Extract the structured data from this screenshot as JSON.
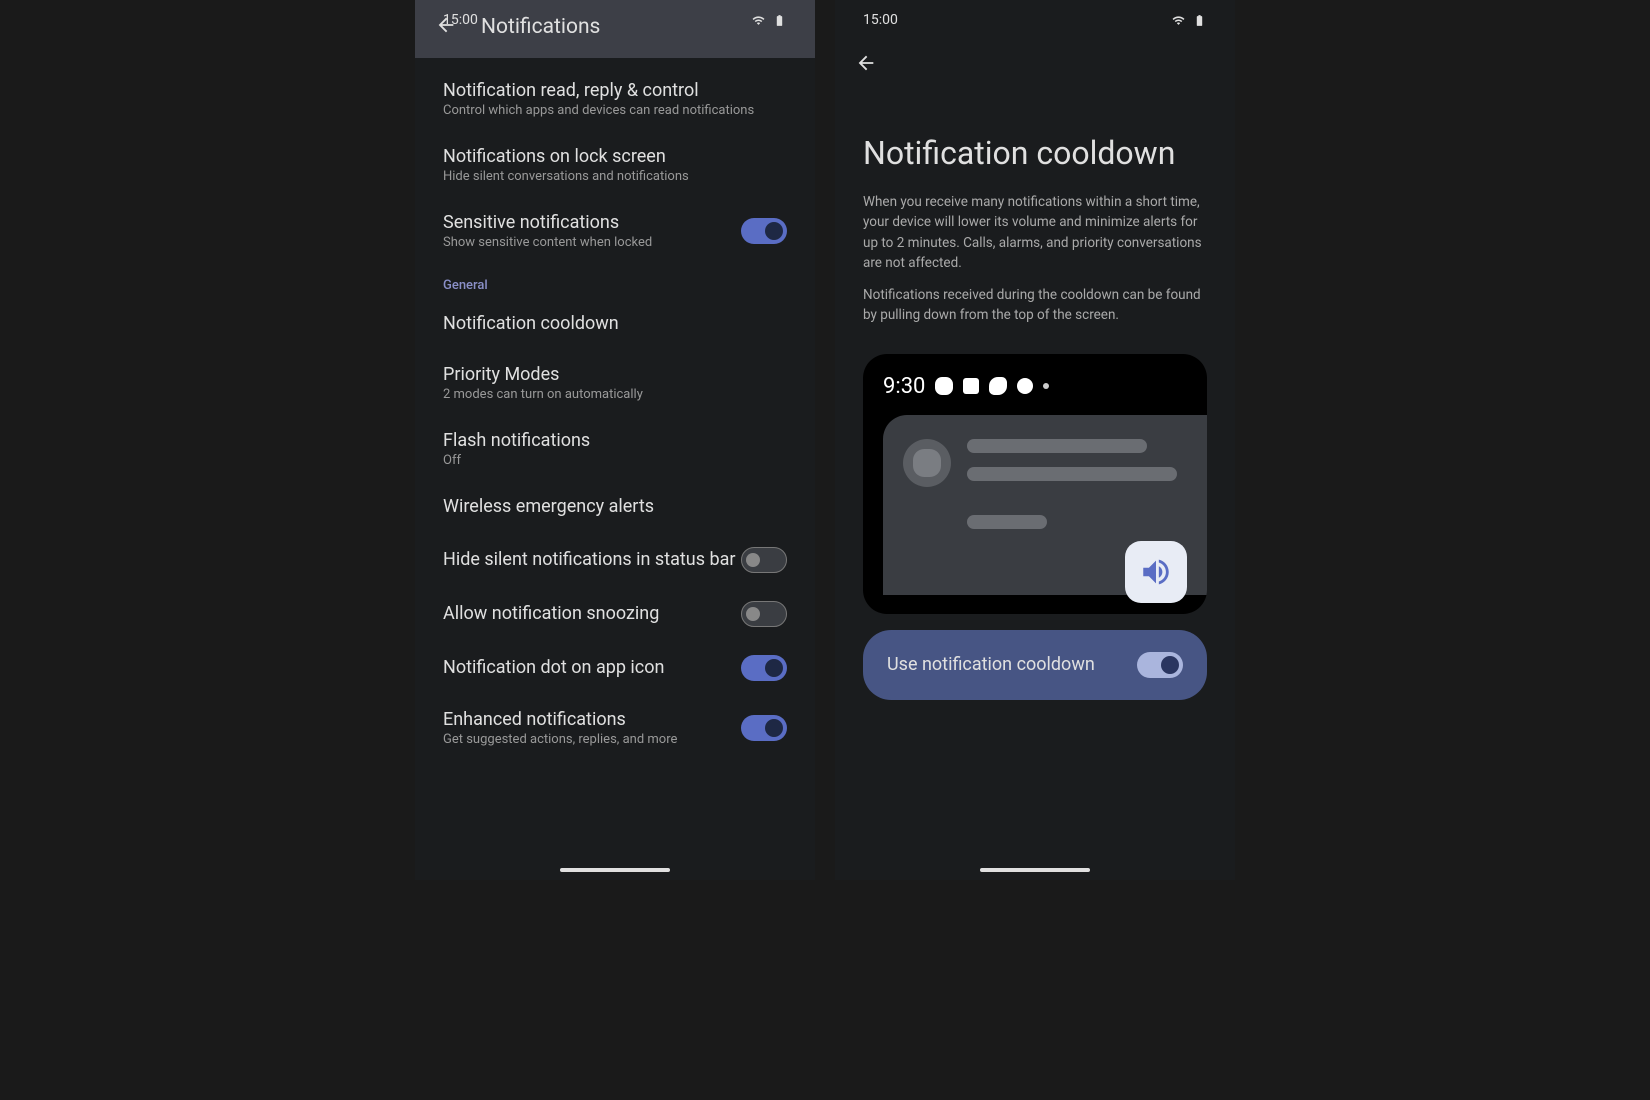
{
  "status": {
    "time": "15:00"
  },
  "screen1": {
    "header_title": "Notifications",
    "items": [
      {
        "title": "Notification read, reply & control",
        "subtitle": "Control which apps and devices can read notifications"
      },
      {
        "title": "Notifications on lock screen",
        "subtitle": "Hide silent conversations and notifications"
      },
      {
        "title": "Sensitive notifications",
        "subtitle": "Show sensitive content when locked"
      }
    ],
    "section": "General",
    "general_items": [
      {
        "title": "Notification cooldown",
        "subtitle": ""
      },
      {
        "title": "Priority Modes",
        "subtitle": "2 modes can turn on automatically"
      },
      {
        "title": "Flash notifications",
        "subtitle": "Off"
      },
      {
        "title": "Wireless emergency alerts",
        "subtitle": ""
      },
      {
        "title": "Hide silent notifications in status bar",
        "subtitle": ""
      },
      {
        "title": "Allow notification snoozing",
        "subtitle": ""
      },
      {
        "title": "Notification dot on app icon",
        "subtitle": ""
      },
      {
        "title": "Enhanced notifications",
        "subtitle": "Get suggested actions, replies, and more"
      }
    ]
  },
  "screen2": {
    "title": "Notification cooldown",
    "desc1": "When you receive many notifications within a short time, your device will lower its volume and minimize alerts for up to 2 minutes. Calls, alarms, and priority conversations are not affected.",
    "desc2": "Notifications received during the cooldown can be found by pulling down from the top of the screen.",
    "preview_time": "9:30",
    "toggle_label": "Use notification cooldown"
  }
}
